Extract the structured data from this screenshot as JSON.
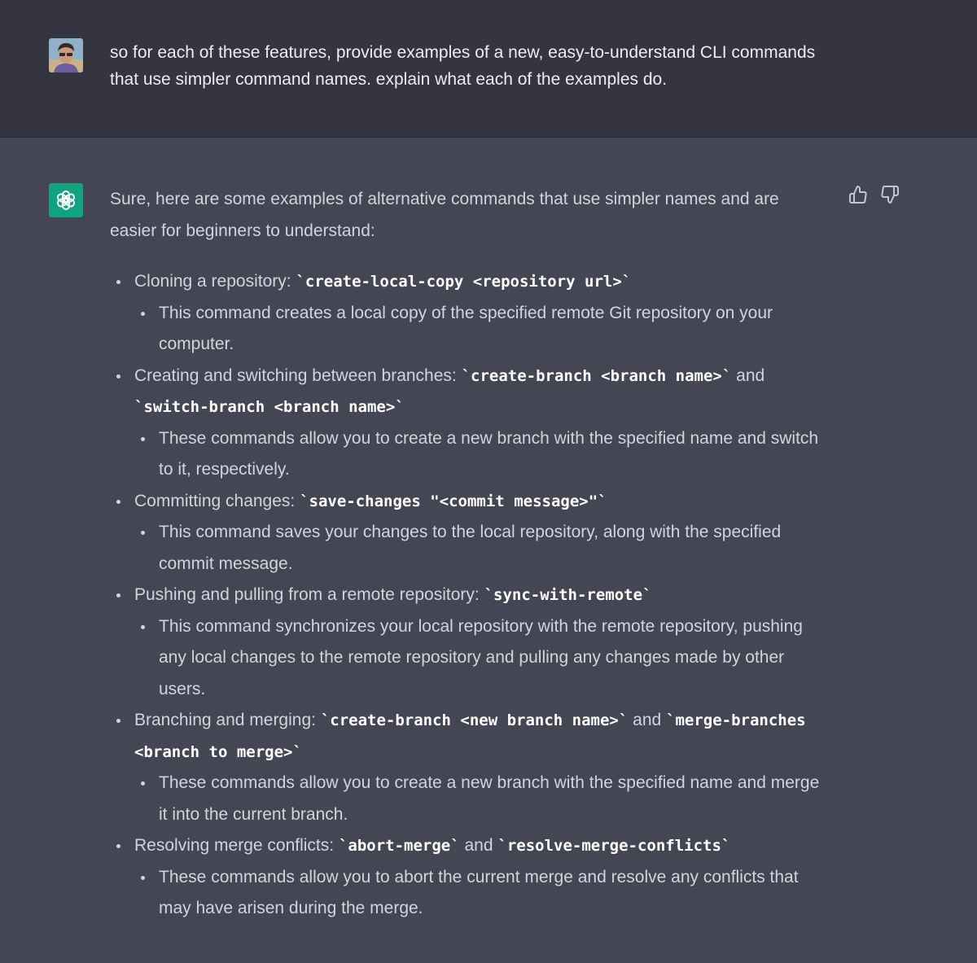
{
  "user_message": {
    "text": "so for each of these features, provide examples of a new, easy-to-understand CLI commands that use simpler command names. explain what each of the examples do."
  },
  "assistant_message": {
    "intro": "Sure, here are some examples of alternative commands that use simpler names and are easier for beginners to understand:",
    "items": [
      {
        "label": "Cloning a repository: ",
        "code1": "`create-local-copy <repository url>`",
        "joiner": "",
        "code2": "",
        "description": "This command creates a local copy of the specified remote Git repository on your computer."
      },
      {
        "label": "Creating and switching between branches: ",
        "code1": "`create-branch <branch name>`",
        "joiner": " and ",
        "code2": "`switch-branch <branch name>`",
        "description": "These commands allow you to create a new branch with the specified name and switch to it, respectively."
      },
      {
        "label": "Committing changes: ",
        "code1": "`save-changes \"<commit message>\"`",
        "joiner": "",
        "code2": "",
        "description": "This command saves your changes to the local repository, along with the specified commit message."
      },
      {
        "label": "Pushing and pulling from a remote repository: ",
        "code1": "`sync-with-remote`",
        "joiner": "",
        "code2": "",
        "description": "This command synchronizes your local repository with the remote repository, pushing any local changes to the remote repository and pulling any changes made by other users."
      },
      {
        "label": "Branching and merging: ",
        "code1": "`create-branch <new branch name>`",
        "joiner": " and ",
        "code2": "`merge-branches <branch to merge>`",
        "description": "These commands allow you to create a new branch with the specified name and merge it into the current branch."
      },
      {
        "label": "Resolving merge conflicts: ",
        "code1": "`abort-merge`",
        "joiner": " and ",
        "code2": "`resolve-merge-conflicts`",
        "description": "These commands allow you to abort the current merge and resolve any conflicts that may have arisen during the merge."
      }
    ]
  },
  "icons": {
    "user_avatar": "user-avatar-photo",
    "bot_avatar": "openai-logo-icon",
    "thumbs_up": "thumbs-up-icon",
    "thumbs_down": "thumbs-down-icon"
  },
  "colors": {
    "user_bg": "#343541",
    "assistant_bg": "#444654",
    "bot_avatar_bg": "#10a37f",
    "text": "#d1d5db"
  }
}
